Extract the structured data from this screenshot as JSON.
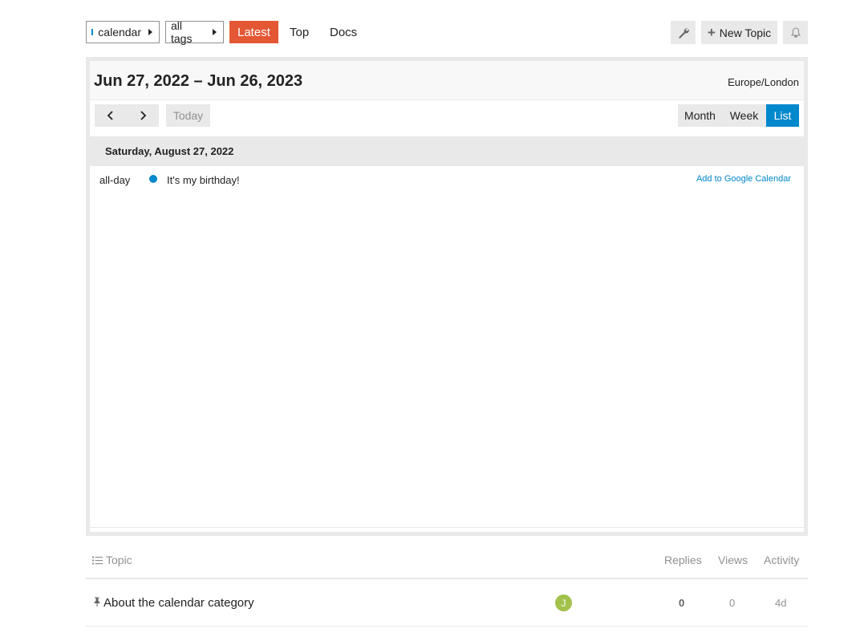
{
  "nav": {
    "category": "calendar",
    "tags": "all tags",
    "links": {
      "latest": "Latest",
      "top": "Top",
      "docs": "Docs"
    },
    "new_topic": "New Topic",
    "colors": {
      "accent": "#e45735",
      "category": "#0088cc"
    }
  },
  "calendar": {
    "title": "Jun 27, 2022 – Jun 26, 2023",
    "timezone": "Europe/London",
    "today": "Today",
    "views": {
      "month": "Month",
      "week": "Week",
      "list": "List"
    },
    "active_view": "List",
    "day_header": "Saturday, August 27, 2022",
    "event": {
      "time": "all-day",
      "title": "It's my birthday!",
      "link": "Add to Google Calendar",
      "color": "#0088cc"
    }
  },
  "topics": {
    "headers": {
      "topic": "Topic",
      "replies": "Replies",
      "views": "Views",
      "activity": "Activity"
    },
    "rows": [
      {
        "title": "About the calendar category",
        "avatar": "J",
        "replies": "0",
        "views": "0",
        "activity": "4d"
      }
    ]
  }
}
